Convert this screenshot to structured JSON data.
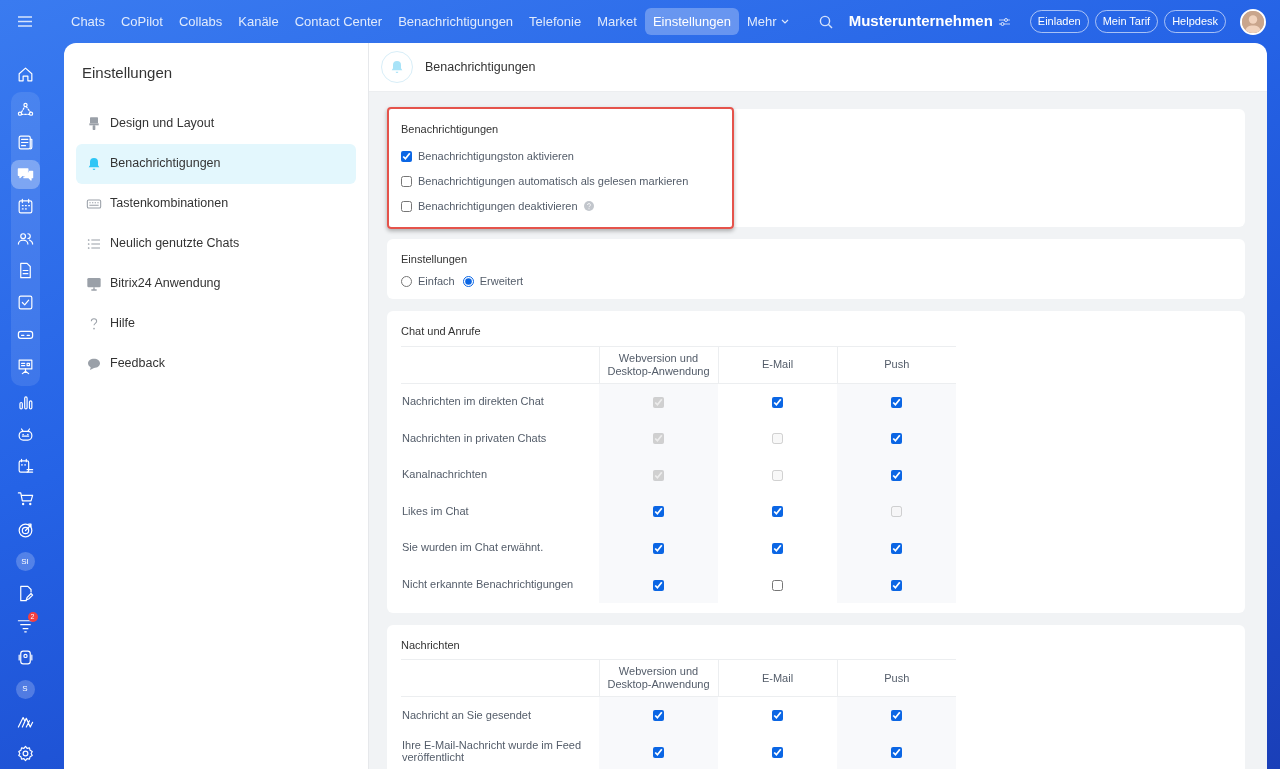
{
  "topbar": {
    "nav": [
      {
        "label": "Chats",
        "selected": false
      },
      {
        "label": "CoPilot",
        "selected": false
      },
      {
        "label": "Collabs",
        "selected": false
      },
      {
        "label": "Kanäle",
        "selected": false
      },
      {
        "label": "Contact Center",
        "selected": false
      },
      {
        "label": "Benachrichtigungen",
        "selected": false
      },
      {
        "label": "Telefonie",
        "selected": false
      },
      {
        "label": "Market",
        "selected": false
      },
      {
        "label": "Einstellungen",
        "selected": true
      }
    ],
    "more": "Mehr",
    "company": "Musterunternehmen",
    "buttons": [
      "Einladen",
      "Mein Tarif",
      "Helpdesk"
    ]
  },
  "rail": {
    "items": [
      {
        "kind": "icon",
        "grouped": false,
        "selected": false
      },
      {
        "kind": "icon",
        "grouped": true,
        "selected": false
      },
      {
        "kind": "icon",
        "grouped": true,
        "selected": false
      },
      {
        "kind": "icon",
        "grouped": true,
        "selected": true
      },
      {
        "kind": "icon",
        "grouped": true,
        "selected": false
      },
      {
        "kind": "icon",
        "grouped": true,
        "selected": false
      },
      {
        "kind": "icon",
        "grouped": true,
        "selected": false
      },
      {
        "kind": "icon",
        "grouped": true,
        "selected": false
      },
      {
        "kind": "icon",
        "grouped": true,
        "selected": false
      },
      {
        "kind": "icon",
        "grouped": true,
        "selected": false
      },
      {
        "kind": "icon",
        "grouped": false,
        "selected": false
      },
      {
        "kind": "icon",
        "grouped": false,
        "selected": false
      },
      {
        "kind": "icon",
        "grouped": false,
        "selected": false
      },
      {
        "kind": "icon",
        "grouped": false,
        "selected": false
      },
      {
        "kind": "icon",
        "grouped": false,
        "selected": false
      },
      {
        "kind": "avatar",
        "text": "SI",
        "grouped": false,
        "selected": false
      },
      {
        "kind": "icon",
        "grouped": false,
        "selected": false
      },
      {
        "kind": "icon",
        "grouped": false,
        "selected": false,
        "badge": "2"
      },
      {
        "kind": "icon",
        "grouped": false,
        "selected": false
      },
      {
        "kind": "avatar",
        "text": "S",
        "grouped": false,
        "selected": false
      },
      {
        "kind": "icon",
        "grouped": false,
        "selected": false
      },
      {
        "kind": "icon",
        "grouped": false,
        "selected": false
      }
    ]
  },
  "sidebar": {
    "title": "Einstellungen",
    "items": [
      {
        "label": "Design und Layout",
        "selected": false
      },
      {
        "label": "Benachrichtigungen",
        "selected": true
      },
      {
        "label": "Tastenkombinationen",
        "selected": false
      },
      {
        "label": "Neulich genutzte Chats",
        "selected": false
      },
      {
        "label": "Bitrix24 Anwendung",
        "selected": false
      },
      {
        "label": "Hilfe",
        "selected": false
      },
      {
        "label": "Feedback",
        "selected": false
      }
    ]
  },
  "header": {
    "title": "Benachrichtigungen"
  },
  "sections": [
    {
      "kind": "checks",
      "title": "Benachrichtigungen",
      "highlighted": true,
      "options": [
        {
          "label": "Benachrichtigungston aktivieren",
          "checked": true
        },
        {
          "label": "Benachrichtigungen automatisch als gelesen markieren",
          "checked": false
        },
        {
          "label": "Benachrichtigungen deaktivieren",
          "checked": false,
          "help": true
        }
      ]
    },
    {
      "kind": "radios",
      "title": "Einstellungen",
      "highlighted": false,
      "options": [
        {
          "label": "Einfach",
          "selected": false
        },
        {
          "label": "Erweitert",
          "selected": true
        }
      ]
    },
    {
      "kind": "table",
      "title": "Chat und Anrufe",
      "highlighted": false,
      "columns": [
        "Webversion und Desktop-Anwendung",
        "E-Mail",
        "Push"
      ],
      "rows": [
        {
          "label": "Nachrichten im direkten Chat",
          "cells": [
            {
              "checked": true,
              "disabled": true
            },
            {
              "checked": true,
              "disabled": false
            },
            {
              "checked": true,
              "disabled": false
            }
          ]
        },
        {
          "label": "Nachrichten in privaten Chats",
          "cells": [
            {
              "checked": true,
              "disabled": true
            },
            {
              "checked": false,
              "disabled": true
            },
            {
              "checked": true,
              "disabled": false
            }
          ]
        },
        {
          "label": "Kanalnachrichten",
          "cells": [
            {
              "checked": true,
              "disabled": true
            },
            {
              "checked": false,
              "disabled": true
            },
            {
              "checked": true,
              "disabled": false
            }
          ]
        },
        {
          "label": "Likes im Chat",
          "cells": [
            {
              "checked": true,
              "disabled": false
            },
            {
              "checked": true,
              "disabled": false
            },
            {
              "checked": false,
              "disabled": true
            }
          ]
        },
        {
          "label": "Sie wurden im Chat erwähnt.",
          "cells": [
            {
              "checked": true,
              "disabled": false
            },
            {
              "checked": true,
              "disabled": false
            },
            {
              "checked": true,
              "disabled": false
            }
          ]
        },
        {
          "label": "Nicht erkannte Benachrichtigungen",
          "cells": [
            {
              "checked": true,
              "disabled": false
            },
            {
              "checked": false,
              "disabled": false
            },
            {
              "checked": true,
              "disabled": false
            }
          ]
        }
      ]
    },
    {
      "kind": "table",
      "title": "Nachrichten",
      "highlighted": false,
      "columns": [
        "Webversion und Desktop-Anwendung",
        "E-Mail",
        "Push"
      ],
      "rows": [
        {
          "label": "Nachricht an Sie gesendet",
          "cells": [
            {
              "checked": true,
              "disabled": false
            },
            {
              "checked": true,
              "disabled": false
            },
            {
              "checked": true,
              "disabled": false
            }
          ]
        },
        {
          "label": "Ihre E-Mail-Nachricht wurde im Feed veröffentlicht",
          "cells": [
            {
              "checked": true,
              "disabled": false
            },
            {
              "checked": true,
              "disabled": false
            },
            {
              "checked": true,
              "disabled": false
            }
          ]
        }
      ]
    }
  ]
}
